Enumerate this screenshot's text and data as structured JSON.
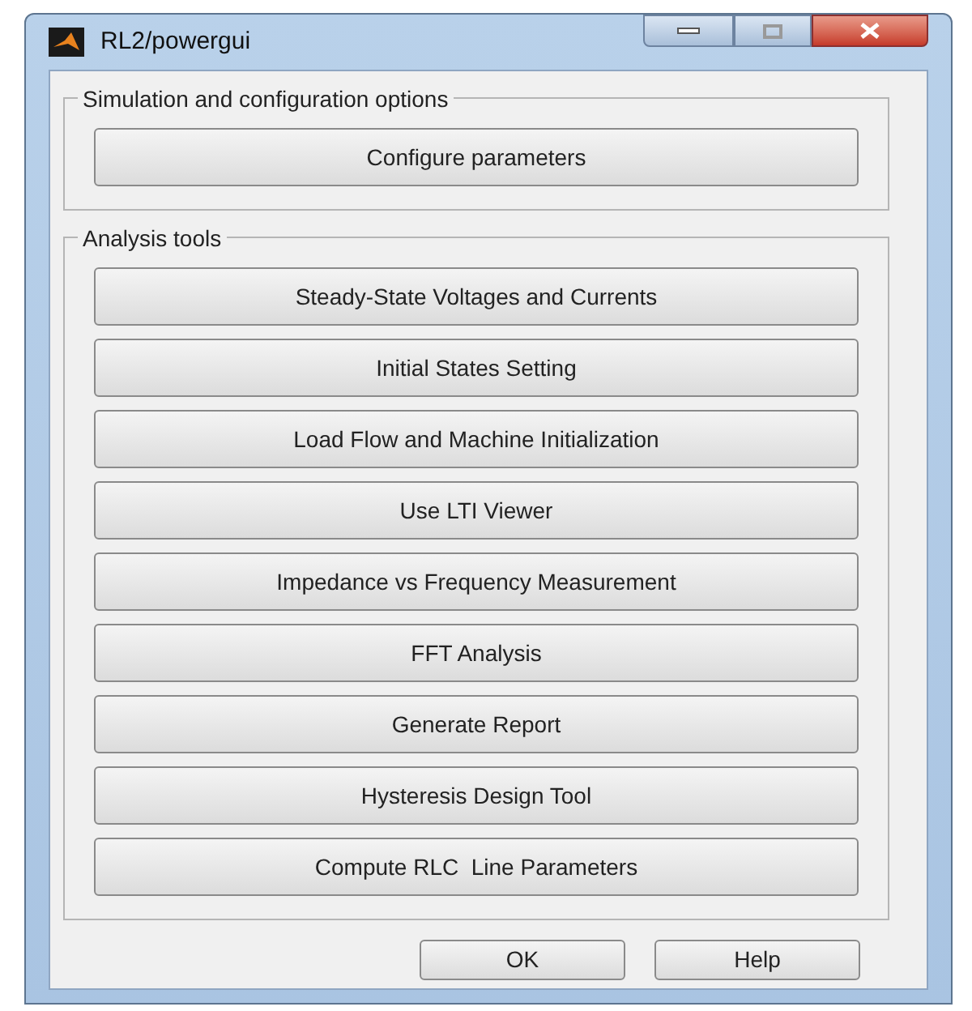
{
  "window": {
    "title": "RL2/powergui"
  },
  "groups": [
    {
      "title": "Simulation and configuration options",
      "buttons": [
        "Configure parameters"
      ]
    },
    {
      "title": "Analysis tools",
      "buttons": [
        "Steady-State Voltages and Currents",
        "Initial States Setting",
        "Load Flow and Machine Initialization",
        "Use LTI Viewer",
        "Impedance vs Frequency Measurement",
        "FFT Analysis",
        "Generate Report",
        "Hysteresis Design Tool",
        "Compute RLC  Line Parameters"
      ]
    }
  ],
  "dialog_buttons": [
    "OK",
    "Help"
  ]
}
